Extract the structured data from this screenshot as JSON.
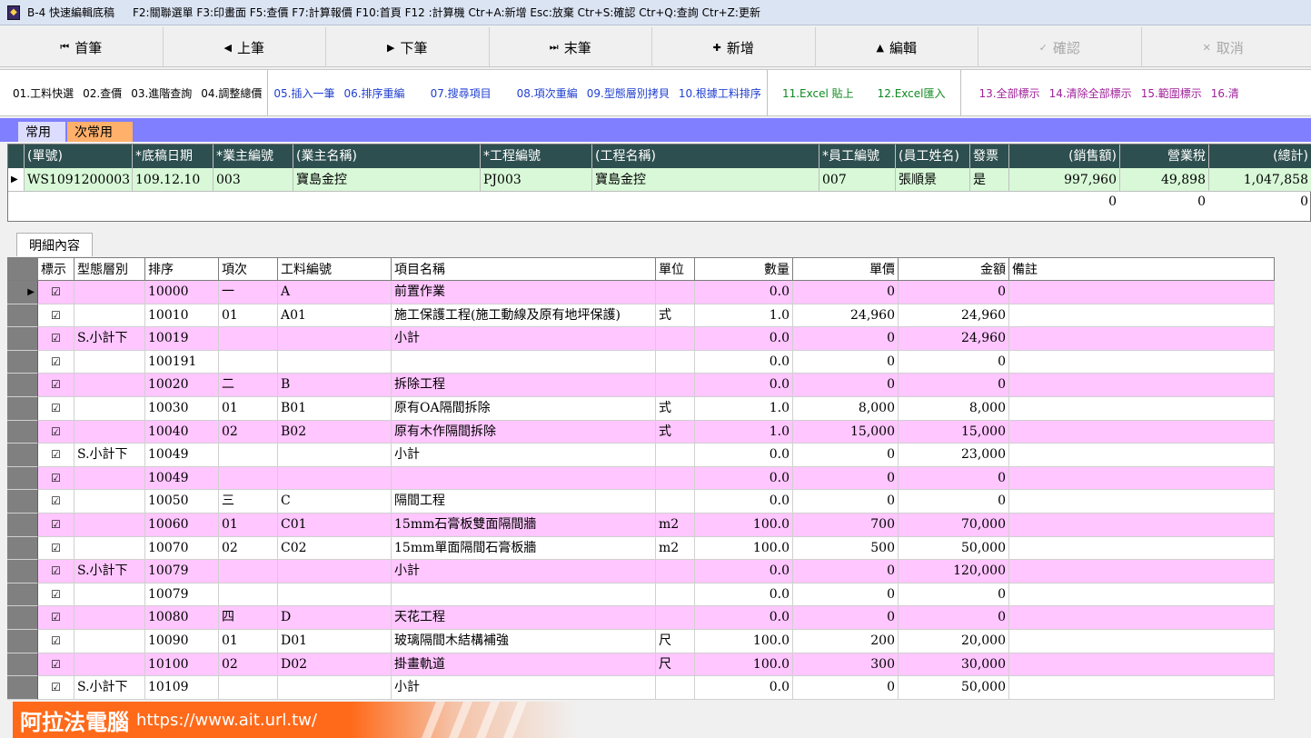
{
  "titlebar": {
    "app_code": "B-4 快速編輯底稿",
    "shortcuts": "F2:關聯選單  F3:印畫面  F5:查價  F7:計算報價  F10:首頁  F12 :計算機  Ctr+A:新增  Esc:放棄  Ctr+S:確認  Ctr+Q:查詢  Ctr+Z:更新"
  },
  "nav": [
    {
      "label": "首筆",
      "icon": "⏮"
    },
    {
      "label": "上筆",
      "icon": "◀"
    },
    {
      "label": "下筆",
      "icon": "▶"
    },
    {
      "label": "末筆",
      "icon": "⏭"
    },
    {
      "label": "新增",
      "icon": "✚"
    },
    {
      "label": "編輯",
      "icon": "▲"
    },
    {
      "label": "確認",
      "icon": "✓"
    },
    {
      "label": "取消",
      "icon": "✕"
    }
  ],
  "tools": {
    "group1": [
      "01.工料快選",
      "02.查價",
      "03.進階查詢",
      "04.調整總價"
    ],
    "group2": [
      "05.插入一筆",
      "06.排序重編",
      "07.搜尋項目",
      "08.項次重編",
      "09.型態層別拷貝",
      "10.根據工料排序"
    ],
    "group3": [
      "11.Excel 貼上",
      "12.Excel匯入"
    ],
    "group4": [
      "13.全部標示",
      "14.清除全部標示",
      "15.範圍標示",
      "16.清"
    ]
  },
  "tabs": {
    "common": "常用",
    "less_common": "次常用"
  },
  "master": {
    "headers": [
      "(單號)",
      "*底稿日期",
      "*業主編號",
      "(業主名稱)",
      "*工程編號",
      "(工程名稱)",
      "*員工編號",
      "(員工姓名)",
      "發票",
      "(銷售額)",
      "營業稅",
      "(總計)"
    ],
    "row": [
      "WS1091200003",
      "109.12.10",
      "003",
      "寶島金控",
      "PJ003",
      "寶島金控",
      "007",
      "張順景",
      "是",
      "997,960",
      "49,898",
      "1,047,858"
    ],
    "totals": [
      "0",
      "0",
      "0"
    ]
  },
  "detail_tab": "明細內容",
  "detail": {
    "headers": [
      "標示",
      "型態層別",
      "排序",
      "項次",
      "工料編號",
      "項目名稱",
      "單位",
      "數量",
      "單價",
      "金額",
      "備註"
    ],
    "rows": [
      [
        "☑",
        "",
        "10000",
        "一",
        "A",
        "前置作業",
        "",
        "0.0",
        "0",
        "0",
        ""
      ],
      [
        "☑",
        "",
        "10010",
        "01",
        "A01",
        "施工保護工程(施工動線及原有地坪保護)",
        "式",
        "1.0",
        "24,960",
        "24,960",
        ""
      ],
      [
        "☑",
        "S.小計下",
        "10019",
        "",
        "",
        "小計",
        "",
        "0.0",
        "0",
        "24,960",
        ""
      ],
      [
        "☑",
        "",
        "100191",
        "",
        "",
        "",
        "",
        "0.0",
        "0",
        "0",
        ""
      ],
      [
        "☑",
        "",
        "10020",
        "二",
        "B",
        "拆除工程",
        "",
        "0.0",
        "0",
        "0",
        ""
      ],
      [
        "☑",
        "",
        "10030",
        "01",
        "B01",
        "原有OA隔間拆除",
        "式",
        "1.0",
        "8,000",
        "8,000",
        ""
      ],
      [
        "☑",
        "",
        "10040",
        "02",
        "B02",
        "原有木作隔間拆除",
        "式",
        "1.0",
        "15,000",
        "15,000",
        ""
      ],
      [
        "☑",
        "S.小計下",
        "10049",
        "",
        "",
        "小計",
        "",
        "0.0",
        "0",
        "23,000",
        ""
      ],
      [
        "☑",
        "",
        "10049",
        "",
        "",
        "",
        "",
        "0.0",
        "0",
        "0",
        ""
      ],
      [
        "☑",
        "",
        "10050",
        "三",
        "C",
        "隔間工程",
        "",
        "0.0",
        "0",
        "0",
        ""
      ],
      [
        "☑",
        "",
        "10060",
        "01",
        "C01",
        "15mm石膏板雙面隔間牆",
        "m2",
        "100.0",
        "700",
        "70,000",
        ""
      ],
      [
        "☑",
        "",
        "10070",
        "02",
        "C02",
        "15mm單面隔間石膏板牆",
        "m2",
        "100.0",
        "500",
        "50,000",
        ""
      ],
      [
        "☑",
        "S.小計下",
        "10079",
        "",
        "",
        "小計",
        "",
        "0.0",
        "0",
        "120,000",
        ""
      ],
      [
        "☑",
        "",
        "10079",
        "",
        "",
        "",
        "",
        "0.0",
        "0",
        "0",
        ""
      ],
      [
        "☑",
        "",
        "10080",
        "四",
        "D",
        "天花工程",
        "",
        "0.0",
        "0",
        "0",
        ""
      ],
      [
        "☑",
        "",
        "10090",
        "01",
        "D01",
        "玻璃隔間木結構補強",
        "尺",
        "100.0",
        "200",
        "20,000",
        ""
      ],
      [
        "☑",
        "",
        "10100",
        "02",
        "D02",
        "掛畫軌道",
        "尺",
        "100.0",
        "300",
        "30,000",
        ""
      ],
      [
        "☑",
        "S.小計下",
        "10109",
        "",
        "",
        "小計",
        "",
        "0.0",
        "0",
        "50,000",
        ""
      ]
    ]
  },
  "watermark": {
    "name": "阿拉法電腦",
    "url": "https://www.ait.url.tw/"
  },
  "colors": {
    "pink_row": "#ffc6ff",
    "master_header": "#2e4f4f",
    "master_row": "#d8f8d8",
    "tab_bar": "#7f7fff"
  }
}
